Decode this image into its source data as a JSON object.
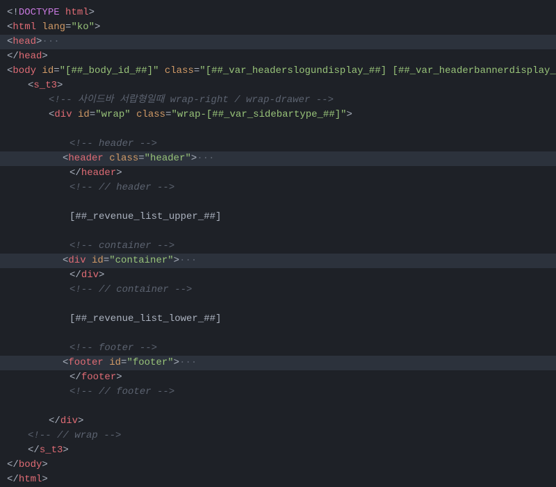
{
  "lines": {
    "l1": {
      "p1": "<!",
      "p2": "DOCTYPE",
      "p3": " ",
      "p4": "html",
      "p5": ">"
    },
    "l2": {
      "p1": "<",
      "p2": "html",
      "p3": " ",
      "p4": "lang",
      "p5": "=",
      "p6": "\"ko\"",
      "p7": ">"
    },
    "l3": {
      "p1": "<",
      "p2": "head",
      "p3": ">",
      "p4": "···"
    },
    "l4": {
      "p1": "</",
      "p2": "head",
      "p3": ">"
    },
    "l5": {
      "p1": "<",
      "p2": "body",
      "p3": " ",
      "p4": "id",
      "p5": "=",
      "p6": "\"[##_body_id_##]\"",
      "p7": " ",
      "p8": "class",
      "p9": "=",
      "p10": "\"[##_var_headerslogundisplay_##] [##_var_headerbannerdisplay_##]\""
    },
    "l6": {
      "p1": "<",
      "p2": "s_t3",
      "p3": ">"
    },
    "l7": {
      "p1": "<!-- 사이드바 서랍형일때 wrap-right / wrap-drawer -->"
    },
    "l8": {
      "p1": "<",
      "p2": "div",
      "p3": " ",
      "p4": "id",
      "p5": "=",
      "p6": "\"wrap\"",
      "p7": " ",
      "p8": "class",
      "p9": "=",
      "p10": "\"wrap-[##_var_sidebartype_##]\"",
      "p11": ">"
    },
    "l9": {
      "p1": ""
    },
    "l10": {
      "p1": "<!-- header -->"
    },
    "l11": {
      "p1": "<",
      "p2": "header",
      "p3": " ",
      "p4": "class",
      "p5": "=",
      "p6": "\"header\"",
      "p7": ">",
      "p8": "···"
    },
    "l12": {
      "p1": "</",
      "p2": "header",
      "p3": ">"
    },
    "l13": {
      "p1": "<!-- // header -->"
    },
    "l14": {
      "p1": ""
    },
    "l15": {
      "p1": "[##_revenue_list_upper_##]"
    },
    "l16": {
      "p1": ""
    },
    "l17": {
      "p1": "<!-- container -->"
    },
    "l18": {
      "p1": "<",
      "p2": "div",
      "p3": " ",
      "p4": "id",
      "p5": "=",
      "p6": "\"container\"",
      "p7": ">",
      "p8": "···"
    },
    "l19": {
      "p1": "</",
      "p2": "div",
      "p3": ">"
    },
    "l20": {
      "p1": "<!-- // container -->"
    },
    "l21": {
      "p1": ""
    },
    "l22": {
      "p1": "[##_revenue_list_lower_##]"
    },
    "l23": {
      "p1": ""
    },
    "l24": {
      "p1": "<!-- footer -->"
    },
    "l25": {
      "p1": "<",
      "p2": "footer",
      "p3": " ",
      "p4": "id",
      "p5": "=",
      "p6": "\"footer\"",
      "p7": ">",
      "p8": "···"
    },
    "l26": {
      "p1": "</",
      "p2": "footer",
      "p3": ">"
    },
    "l27": {
      "p1": "<!-- // footer -->"
    },
    "l28": {
      "p1": ""
    },
    "l29": {
      "p1": "</",
      "p2": "div",
      "p3": ">"
    },
    "l30": {
      "p1": "<!-- // wrap -->"
    },
    "l31": {
      "p1": "</",
      "p2": "s_t3",
      "p3": ">"
    },
    "l32": {
      "p1": "</",
      "p2": "body",
      "p3": ">"
    },
    "l33": {
      "p1": "</",
      "p2": "html",
      "p3": ">"
    }
  }
}
